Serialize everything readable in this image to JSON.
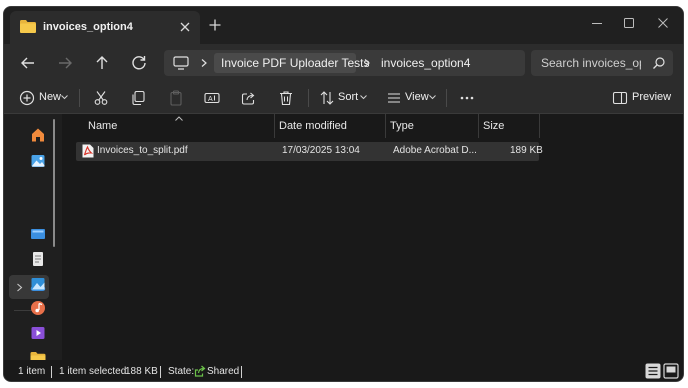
{
  "tab": {
    "title": "invoices_option4"
  },
  "breadcrumb": {
    "items": [
      "Invoice PDF Uploader Tests",
      "invoices_option4"
    ]
  },
  "search": {
    "placeholder": "Search invoices_opti"
  },
  "commands": {
    "new_label": "New",
    "sort_label": "Sort",
    "view_label": "View",
    "preview_label": "Preview"
  },
  "columns": [
    "Name",
    "Date modified",
    "Type",
    "Size"
  ],
  "files": [
    {
      "name": "Invoices_to_split.pdf",
      "date": "17/03/2025 13:04",
      "type": "Adobe Acrobat D...",
      "size": "189 KB"
    }
  ],
  "status": {
    "count": "1 item",
    "selected": "1 item selected",
    "selected_size": "188 KB",
    "state_label": "State:",
    "state_value": "Shared"
  },
  "colors": {
    "accent": "#4cc2ff",
    "folder": "#e8b53c",
    "pdf": "#d93025"
  }
}
